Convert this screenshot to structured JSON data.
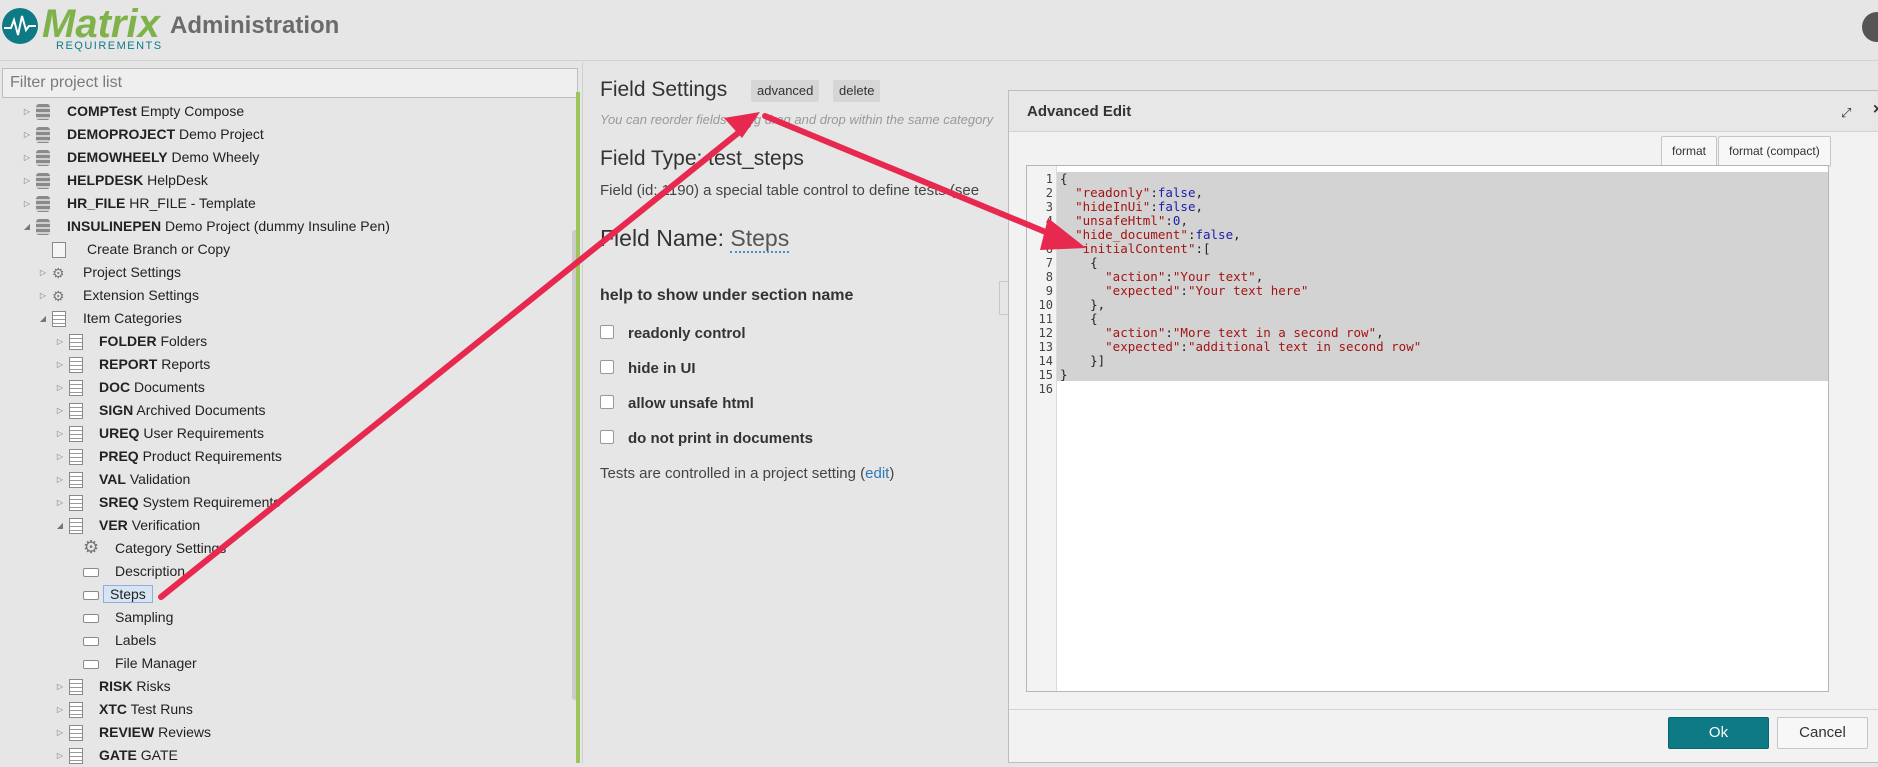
{
  "header": {
    "logo_word": "Matrix",
    "logo_sub": "REQUIREMENTS",
    "title": "Administration"
  },
  "sidebar": {
    "filter_placeholder": "Filter project list",
    "projects": [
      {
        "key": "COMPTest",
        "name": "Empty Compose"
      },
      {
        "key": "DEMOPROJECT",
        "name": "Demo Project"
      },
      {
        "key": "DEMOWHEELY",
        "name": "Demo Wheely"
      },
      {
        "key": "HELPDESK",
        "name": "HelpDesk"
      },
      {
        "key": "HR_FILE",
        "name": "HR_FILE - Template"
      },
      {
        "key": "INSULINEPEN",
        "name": "Demo Project (dummy Insuline Pen)"
      }
    ],
    "project_children": [
      {
        "label": "Create Branch or Copy"
      },
      {
        "label": "Project Settings"
      },
      {
        "label": "Extension Settings"
      },
      {
        "label": "Item Categories"
      }
    ],
    "categories": [
      {
        "key": "FOLDER",
        "name": "Folders"
      },
      {
        "key": "REPORT",
        "name": "Reports"
      },
      {
        "key": "DOC",
        "name": "Documents"
      },
      {
        "key": "SIGN",
        "name": "Archived Documents"
      },
      {
        "key": "UREQ",
        "name": "User Requirements"
      },
      {
        "key": "PREQ",
        "name": "Product Requirements"
      },
      {
        "key": "VAL",
        "name": "Validation"
      },
      {
        "key": "SREQ",
        "name": "System Requirements"
      },
      {
        "key": "VER",
        "name": "Verification"
      }
    ],
    "ver_children": [
      {
        "label": "Category Settings"
      },
      {
        "label": "Description"
      },
      {
        "label": "Steps"
      },
      {
        "label": "Sampling"
      },
      {
        "label": "Labels"
      },
      {
        "label": "File Manager"
      }
    ],
    "more_categories": [
      {
        "key": "RISK",
        "name": "Risks"
      },
      {
        "key": "XTC",
        "name": "Test Runs"
      },
      {
        "key": "REVIEW",
        "name": "Reviews"
      },
      {
        "key": "GATE",
        "name": "GATE"
      }
    ]
  },
  "main": {
    "title": "Field Settings",
    "advanced_label": "advanced",
    "delete_label": "delete",
    "note": "You can reorder fields using drag and drop within the same category",
    "field_type": "Field Type: test_steps",
    "field_desc": "Field (id: 1190) a special table control to define tests (see",
    "field_name_label": "Field Name:",
    "field_name_value": "Steps",
    "help_label": "help to show under section name",
    "options": [
      {
        "label": "readonly control"
      },
      {
        "label": "hide in UI"
      },
      {
        "label": "allow unsafe html"
      },
      {
        "label": "do not print in documents"
      }
    ],
    "tests_prefix": "Tests are controlled in a project setting (",
    "tests_link": "edit",
    "tests_suffix": ")"
  },
  "dialog": {
    "title": "Advanced Edit",
    "format_label": "format",
    "format_compact_label": "format (compact)",
    "line_numbers": [
      "1",
      "2",
      "3",
      "4",
      "5",
      "6",
      "7",
      "8",
      "9",
      "10",
      "11",
      "12",
      "13",
      "14",
      "15",
      "16"
    ],
    "ok_label": "Ok",
    "cancel_label": "Cancel"
  },
  "colors": {
    "accent": "#0d7a86",
    "logo_green": "#7fb24a",
    "arrow": "#e8294f"
  }
}
